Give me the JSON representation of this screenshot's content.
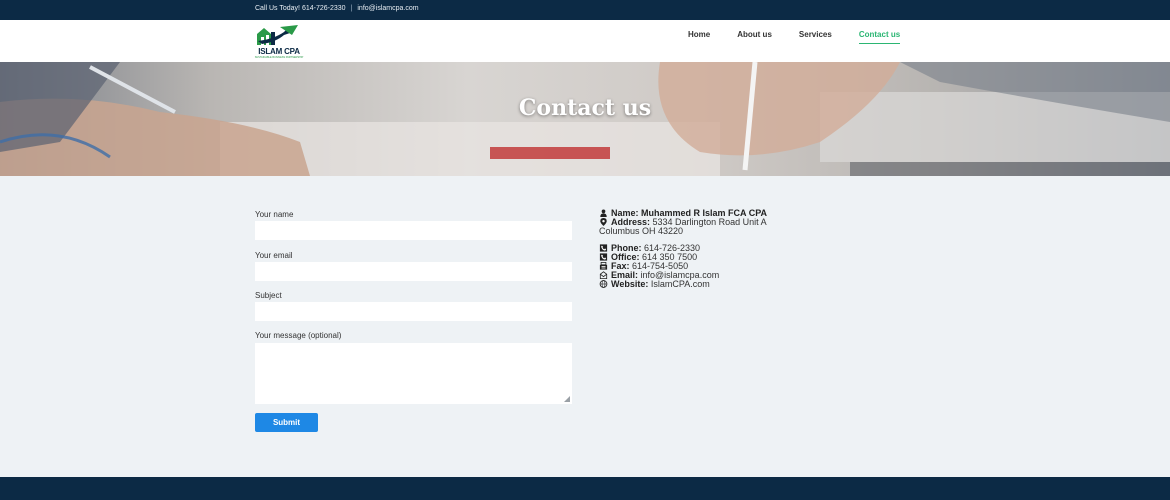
{
  "topbar": {
    "call": "Call Us Today! 614-726-2330",
    "separator": "|",
    "email": "info@islamcpa.com"
  },
  "logo": {
    "name": "ISLAM CPA",
    "tagline": "SUSTAINABLE BUSINESS PARTNERSHIP"
  },
  "nav": [
    {
      "label": "Home"
    },
    {
      "label": "About us"
    },
    {
      "label": "Services"
    },
    {
      "label": "Contact us",
      "active": true
    }
  ],
  "hero": {
    "title": "Contact us"
  },
  "form": {
    "name_label": "Your name",
    "email_label": "Your email",
    "subject_label": "Subject",
    "message_label": "Your message (optional)",
    "submit_label": "Submit"
  },
  "contact": {
    "name_label": "Name:",
    "name_value": "Muhammed R Islam FCA CPA",
    "address_label": "Address:",
    "address_line1": "5334 Darlington Road Unit A",
    "address_line2": "Columbus OH 43220",
    "phone_label": "Phone:",
    "phone_value": "614-726-2330",
    "office_label": "Office:",
    "office_value": "614 350 7500",
    "fax_label": "Fax:",
    "fax_value": "614-754-5050",
    "email_label": "Email:",
    "email_value": "info@islamcpa.com",
    "website_label": "Website:",
    "website_value": "IslamCPA.com"
  },
  "colors": {
    "navy": "#0c2a45",
    "accent_green": "#2bb673",
    "button_blue": "#1e88e5"
  },
  "icons": [
    "user-icon",
    "map-pin-icon",
    "phone-icon",
    "office-phone-icon",
    "fax-icon",
    "envelope-icon",
    "globe-icon"
  ]
}
